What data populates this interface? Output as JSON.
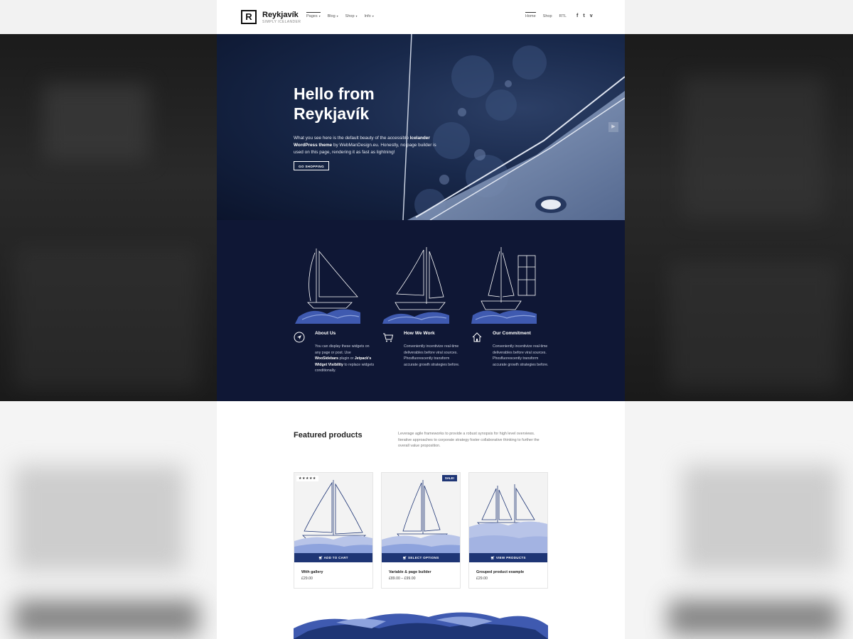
{
  "site": {
    "title": "Reykjavík",
    "tagline": "SIMPLY ICELANDER",
    "logo_letter": "R"
  },
  "nav_left": [
    {
      "label": "Pages",
      "caret": "▾"
    },
    {
      "label": "Blog",
      "caret": "▾"
    },
    {
      "label": "Shop",
      "caret": "▾"
    },
    {
      "label": "Info",
      "caret": "▾"
    }
  ],
  "nav_right": [
    {
      "label": "Home",
      "active": true
    },
    {
      "label": "Shop"
    },
    {
      "label": "RTL"
    }
  ],
  "social": [
    {
      "icon": "facebook-icon",
      "glyph": "f"
    },
    {
      "icon": "twitter-icon",
      "glyph": "t"
    },
    {
      "icon": "vimeo-icon",
      "glyph": "v"
    }
  ],
  "hero": {
    "title_line1": "Hello from",
    "title_line2": "Reykjavík",
    "text_1": "What you see here is the default beauty of the accessible ",
    "text_bold": "Icelander WordPress theme",
    "text_2": " by WebManDesign.eu. Honestly, no page builder is used on this page, rendering it as fast as lightning!",
    "button": "GO SHOPPING",
    "next_arrow": "▶"
  },
  "features": [
    {
      "icon": "navigation-arrow-icon",
      "title": "About Us",
      "text_1": "You can display these widgets on any page or post. Use ",
      "bold_1": "WooSidebars",
      "text_2": " plugin or ",
      "bold_2": "Jetpack's Widget Visibility",
      "text_3": " to replace widgets conditionally."
    },
    {
      "icon": "cart-icon",
      "title": "How We Work",
      "text": "Conveniently incentivize real-time deliverables before viral sources. Phosfluorescently transform accurate growth strategies before."
    },
    {
      "icon": "home-icon",
      "title": "Our Commitment",
      "text": "Conveniently incentivize real-time deliverables before viral sources. Phosfluorescently transform accurate growth strategies before."
    }
  ],
  "featured": {
    "title": "Featured products",
    "description": "Leverage agile frameworks to provide a robust synopsis for high level overviews. Iterative approaches to corporate strategy foster collaborative thinking to further the overall value proposition."
  },
  "products": [
    {
      "name": "With gallery",
      "price": "£29.00",
      "button": "ADD TO CART",
      "badge": "★★★★★"
    },
    {
      "name": "Variable & page builder",
      "price": "£89.00 – £99.00",
      "button": "SELECT OPTIONS",
      "badge": "SALE!"
    },
    {
      "name": "Grouped product example",
      "price": "£29.00",
      "button": "VIEW PRODUCTS"
    }
  ],
  "colors": {
    "navy": "#0f1735",
    "accent": "#1e3575",
    "wave": "#3f5ab0"
  }
}
